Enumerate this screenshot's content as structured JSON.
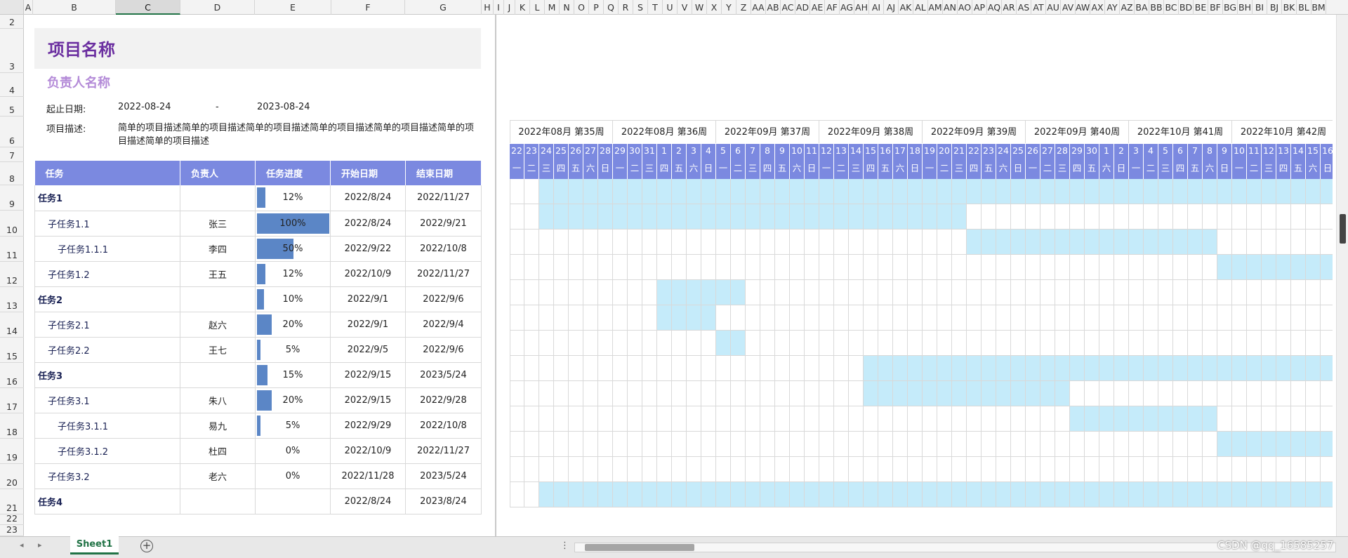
{
  "columns": [
    "A",
    "B",
    "C",
    "D",
    "E",
    "F",
    "G",
    "H",
    "I",
    "J",
    "K",
    "L",
    "M",
    "N",
    "O",
    "P",
    "Q",
    "R",
    "S",
    "T",
    "U",
    "V",
    "W",
    "X",
    "Y",
    "Z",
    "AA",
    "AB",
    "AC",
    "AD",
    "AE",
    "AF",
    "AG",
    "AH",
    "AI",
    "AJ",
    "AK",
    "AL",
    "AM",
    "AN",
    "AO",
    "AP",
    "AQ",
    "AR",
    "AS",
    "AT",
    "AU",
    "AV",
    "AW",
    "AX",
    "AY",
    "AZ",
    "BA",
    "BB",
    "BC",
    "BD",
    "BE",
    "BF",
    "BG",
    "BH",
    "BI",
    "BJ",
    "BK",
    "BL",
    "BM"
  ],
  "selected_column": "C",
  "rows": [
    "2",
    "3",
    "4",
    "5",
    "6",
    "7",
    "8",
    "9",
    "10",
    "11",
    "12",
    "13",
    "14",
    "15",
    "16",
    "17",
    "18",
    "19",
    "20",
    "21",
    "22",
    "23"
  ],
  "project": {
    "title": "项目名称",
    "owner": "负责人名称",
    "date_label": "起止日期:",
    "start": "2022-08-24",
    "dash": "-",
    "end": "2023-08-24",
    "desc_label": "项目描述:",
    "description": "简单的项目描述简单的项目描述简单的项目描述简单的项目描述简单的项目描述简单的项目描述简单的项目描述"
  },
  "table": {
    "headers": [
      "任务",
      "负责人",
      "任务进度",
      "开始日期",
      "结束日期"
    ],
    "tasks": [
      {
        "name": "任务1",
        "level": 0,
        "owner": "",
        "progress": "12%",
        "pct": 0.12,
        "start": "2022/8/24",
        "end": "2022/11/27"
      },
      {
        "name": "子任务1.1",
        "level": 1,
        "owner": "张三",
        "progress": "100%",
        "pct": 1.0,
        "start": "2022/8/24",
        "end": "2022/9/21"
      },
      {
        "name": "子任务1.1.1",
        "level": 2,
        "owner": "李四",
        "progress": "50%",
        "pct": 0.5,
        "start": "2022/9/22",
        "end": "2022/10/8"
      },
      {
        "name": "子任务1.2",
        "level": 1,
        "owner": "王五",
        "progress": "12%",
        "pct": 0.12,
        "start": "2022/10/9",
        "end": "2022/11/27"
      },
      {
        "name": "任务2",
        "level": 0,
        "owner": "",
        "progress": "10%",
        "pct": 0.1,
        "start": "2022/9/1",
        "end": "2022/9/6"
      },
      {
        "name": "子任务2.1",
        "level": 1,
        "owner": "赵六",
        "progress": "20%",
        "pct": 0.2,
        "start": "2022/9/1",
        "end": "2022/9/4"
      },
      {
        "name": "子任务2.2",
        "level": 1,
        "owner": "王七",
        "progress": "5%",
        "pct": 0.05,
        "start": "2022/9/5",
        "end": "2022/9/6"
      },
      {
        "name": "任务3",
        "level": 0,
        "owner": "",
        "progress": "15%",
        "pct": 0.15,
        "start": "2022/9/15",
        "end": "2023/5/24"
      },
      {
        "name": "子任务3.1",
        "level": 1,
        "owner": "朱八",
        "progress": "20%",
        "pct": 0.2,
        "start": "2022/9/15",
        "end": "2022/9/28"
      },
      {
        "name": "子任务3.1.1",
        "level": 2,
        "owner": "易九",
        "progress": "5%",
        "pct": 0.05,
        "start": "2022/9/29",
        "end": "2022/10/8"
      },
      {
        "name": "子任务3.1.2",
        "level": 2,
        "owner": "杜四",
        "progress": "0%",
        "pct": 0,
        "start": "2022/10/9",
        "end": "2022/11/27"
      },
      {
        "name": "子任务3.2",
        "level": 1,
        "owner": "老六",
        "progress": "0%",
        "pct": 0,
        "start": "2022/11/28",
        "end": "2023/5/24"
      },
      {
        "name": "任务4",
        "level": 0,
        "owner": "",
        "progress": "",
        "pct": 0,
        "start": "2022/8/24",
        "end": "2023/8/24"
      }
    ]
  },
  "gantt": {
    "weeks": [
      "2022年08月 第35周",
      "2022年08月 第36周",
      "2022年09月 第37周",
      "2022年09月 第38周",
      "2022年09月 第39周",
      "2022年09月 第40周",
      "2022年10月 第41周",
      "2022年10月 第42周"
    ],
    "days": [
      "22",
      "23",
      "24",
      "25",
      "26",
      "27",
      "28",
      "29",
      "30",
      "31",
      "1",
      "2",
      "3",
      "4",
      "5",
      "6",
      "7",
      "8",
      "9",
      "10",
      "11",
      "12",
      "13",
      "14",
      "15",
      "16",
      "17",
      "18",
      "19",
      "20",
      "21",
      "22",
      "23",
      "24",
      "25",
      "26",
      "27",
      "28",
      "29",
      "30",
      "1",
      "2",
      "3",
      "4",
      "5",
      "6",
      "7",
      "8",
      "9",
      "10",
      "11",
      "12",
      "13",
      "14",
      "15",
      "16"
    ],
    "weekdays": [
      "一",
      "二",
      "三",
      "四",
      "五",
      "六",
      "日"
    ],
    "bars": [
      [
        2,
        56
      ],
      [
        2,
        31
      ],
      [
        31,
        48
      ],
      [
        48,
        56
      ],
      [
        10,
        16
      ],
      [
        10,
        14
      ],
      [
        14,
        16
      ],
      [
        24,
        56
      ],
      [
        24,
        38
      ],
      [
        38,
        48
      ],
      [
        48,
        56
      ],
      [
        56,
        56
      ],
      [
        2,
        56
      ]
    ]
  },
  "sheet_tab": "Sheet1",
  "add_sheet_icon": "plus-circle-icon",
  "watermark": "CSDN @qq_16585257"
}
